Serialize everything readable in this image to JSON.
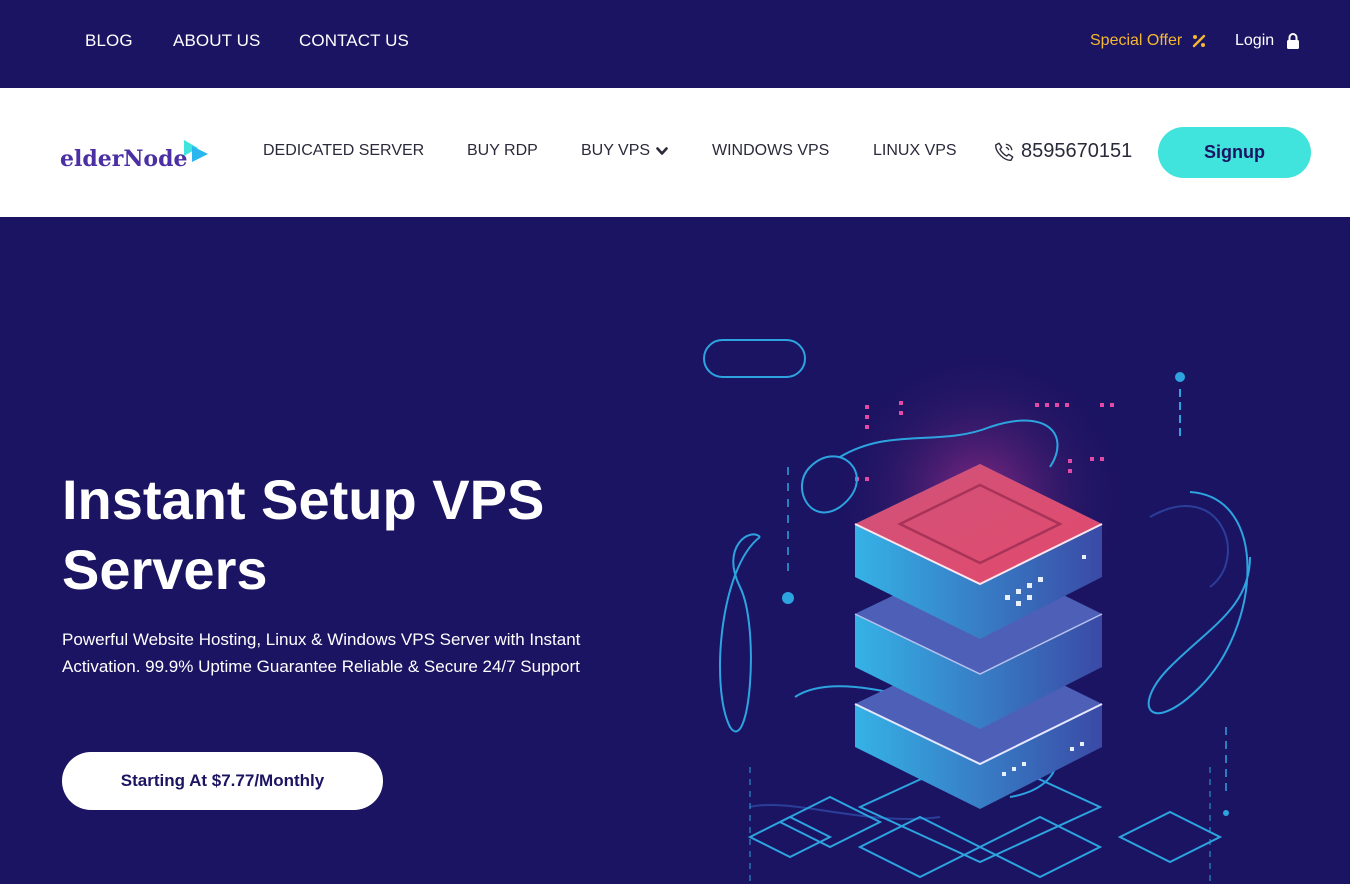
{
  "topbar": {
    "links": [
      "BLOG",
      "ABOUT US",
      "CONTACT US"
    ],
    "special_offer": "Special Offer",
    "login": "Login"
  },
  "mainnav": {
    "logo_text": "elderNode",
    "items": [
      "DEDICATED SERVER",
      "BUY RDP",
      "BUY VPS",
      "WINDOWS VPS",
      "LINUX VPS"
    ],
    "phone": "8595670151",
    "signup": "Signup"
  },
  "hero": {
    "title": "Instant Setup VPS Servers",
    "subtitle": "Powerful Website Hosting, Linux & Windows VPS Server with Instant Activation. 99.9% Uptime Guarantee Reliable & Secure 24/7 Support",
    "cta": "Starting At $7.77/Monthly"
  },
  "colors": {
    "navy": "#1b1462",
    "accent_cyan": "#41e3dd",
    "offer_gold": "#f5b82e"
  },
  "icons": {
    "offer": "percent-icon",
    "login": "lock-icon",
    "phone": "phone-icon",
    "dropdown": "chevron-down-icon"
  }
}
